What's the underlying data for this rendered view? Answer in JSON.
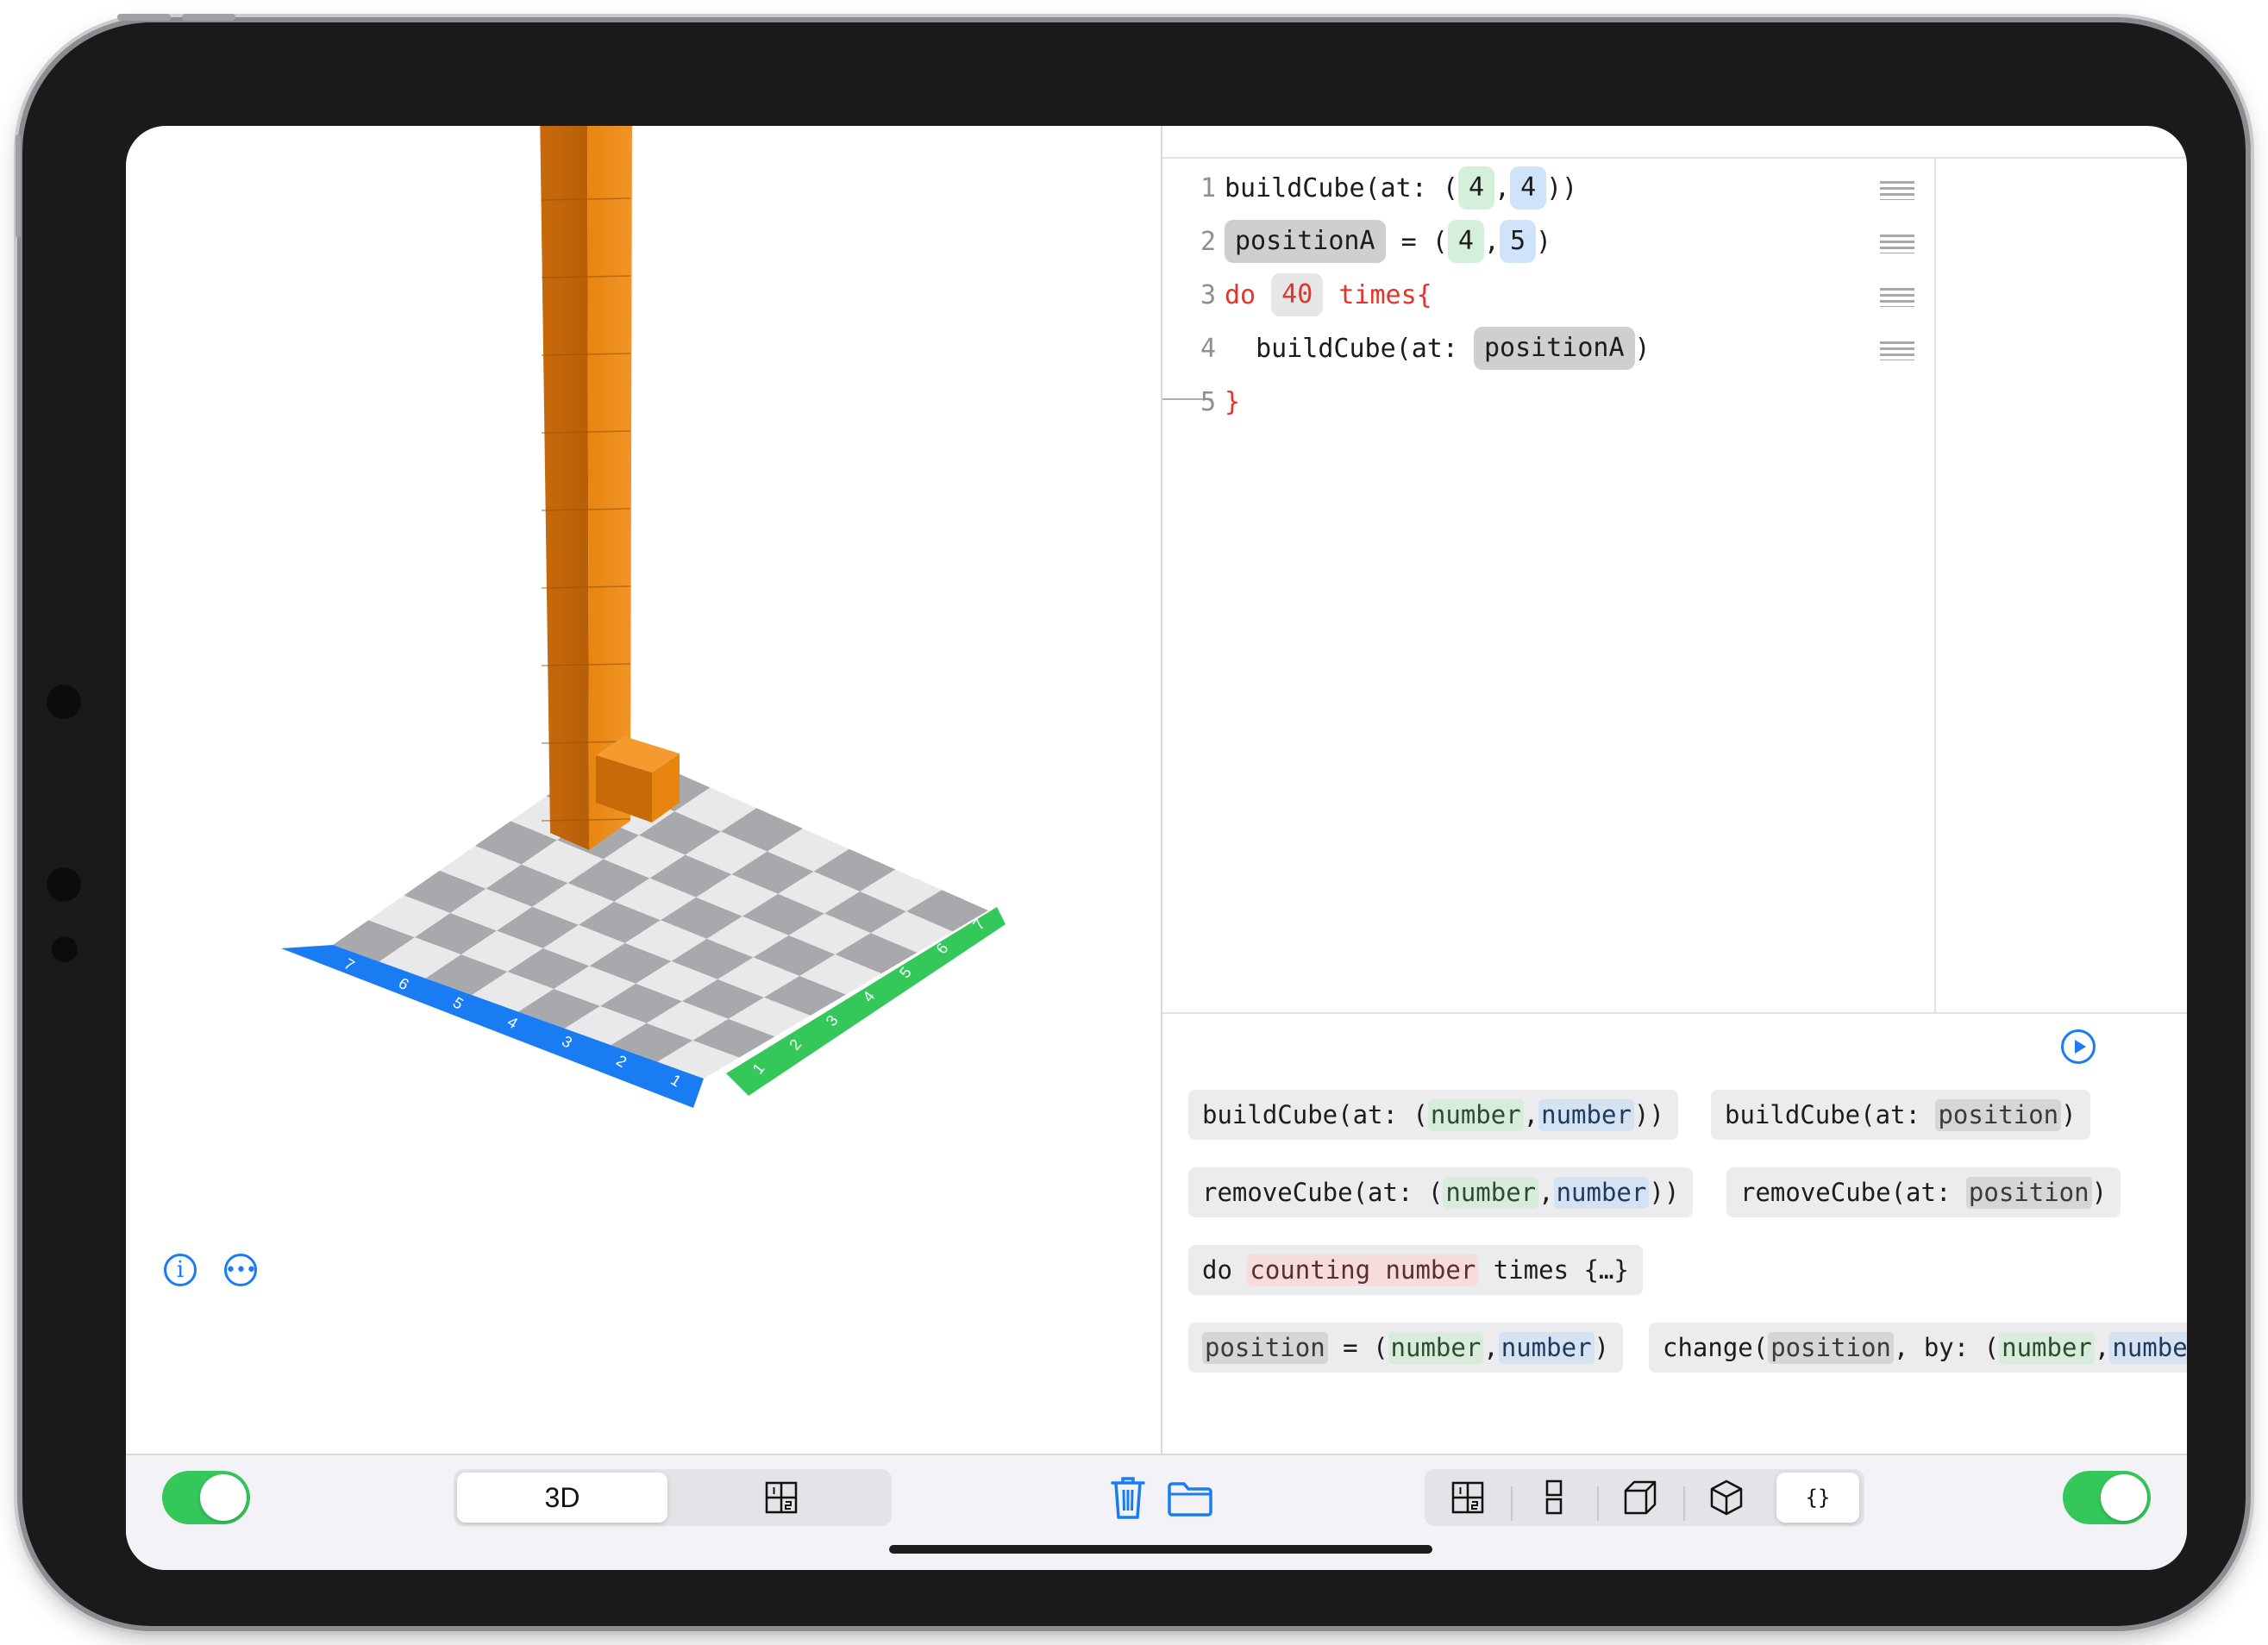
{
  "editor": {
    "lines": [
      {
        "num": "1",
        "text_a": "buildCube(at: (",
        "x": "4",
        "comma": ",",
        "y": "4",
        "text_b": "))"
      },
      {
        "num": "2",
        "var": "positionA",
        "eq": " = (",
        "x": "4",
        "comma": ",",
        "y": "5",
        "close": ")"
      },
      {
        "num": "3",
        "kw_do": "do ",
        "count": "40",
        "kw_times": " times{"
      },
      {
        "num": "4",
        "text_a": "  buildCube(at: ",
        "var": "positionA",
        "close": ")"
      },
      {
        "num": "5",
        "brace": "}"
      }
    ]
  },
  "palette": {
    "b1": {
      "a": "buildCube(at: (",
      "n1": "number",
      "c": ",",
      "n2": "number",
      "z": "))"
    },
    "b2": {
      "a": "buildCube(at: ",
      "p": "position",
      "z": ")"
    },
    "b3": {
      "a": "removeCube(at: (",
      "n1": "number",
      "c": ",",
      "n2": "number",
      "z": "))"
    },
    "b4": {
      "a": "removeCube(at: ",
      "p": "position",
      "z": ")"
    },
    "b5": {
      "a": "do ",
      "p": "counting number",
      "z": " times {…}"
    },
    "b6": {
      "p": "position",
      "a": " = (",
      "n1": "number",
      "c": ",",
      "n2": "number",
      "z": ")"
    },
    "b7": {
      "a": "change(",
      "p": "position",
      "b": ", by: (",
      "n1": "number",
      "c": ",",
      "n2": "numbe"
    }
  },
  "scene": {
    "axis_blue_labels": [
      "7",
      "6",
      "5",
      "4",
      "3",
      "2",
      "1"
    ],
    "axis_green_labels": [
      "1",
      "2",
      "3",
      "4",
      "5",
      "6",
      "7"
    ]
  },
  "toolbar": {
    "view_3d": "3D",
    "code_view_label": "{}"
  },
  "colors": {
    "accent": "#1a7cf3",
    "toggle_on": "#34c759",
    "cube": "#e07d10",
    "axis_blue": "#1a7cf3",
    "axis_green": "#34c759"
  }
}
